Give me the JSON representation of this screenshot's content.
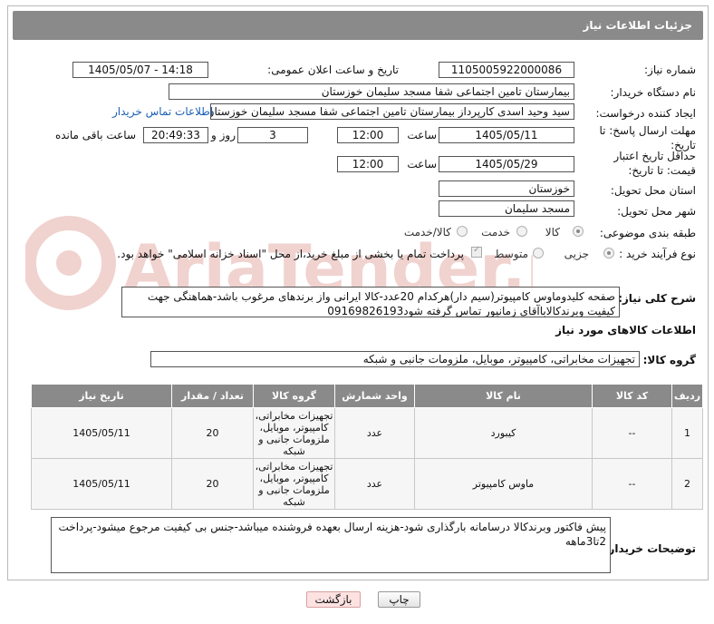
{
  "header": {
    "title": "جزئیات اطلاعات نیاز"
  },
  "fields": {
    "need_number_label": "شماره نیاز:",
    "need_number": "1105005922000086",
    "announce_label": "تاریخ و ساعت اعلان عمومی:",
    "announce_value": "1405/05/07 - 14:18",
    "buyer_org_label": "نام دستگاه خریدار:",
    "buyer_org": "بیمارستان تامین اجتماعی شفا مسجد سلیمان خوزستان",
    "requester_label": "ایجاد کننده درخواست:",
    "requester": "سید وحید اسدی کارپرداز بیمارستان تامین اجتماعی شفا مسجد سلیمان خوزستان",
    "contact_link": "اطلاعات تماس خریدار",
    "deadline_label": "مهلت ارسال پاسخ: تا تاریخ:",
    "deadline_date": "1405/05/11",
    "time_label": "ساعت",
    "deadline_time": "12:00",
    "days_value": "3",
    "days_label": "روز و",
    "remaining_time": "20:49:33",
    "remaining_label": "ساعت باقی مانده",
    "validity_label": "حداقل تاریخ اعتبار قیمت: تا تاریخ:",
    "validity_date": "1405/05/29",
    "validity_time": "12:00",
    "province_label": "استان محل تحویل:",
    "province": "خوزستان",
    "city_label": "شهر محل تحویل:",
    "city": "مسجد سلیمان",
    "category_label": "طبقه بندی موضوعی:",
    "category_options": [
      "کالا",
      "خدمت",
      "کالا/خدمت"
    ],
    "process_label": "نوع فرآیند خرید :",
    "process_options": [
      "جزیی",
      "متوسط"
    ],
    "payment_note": "پرداخت تمام یا بخشی از مبلغ خرید،از محل \"اسناد خزانه اسلامی\" خواهد بود."
  },
  "summary": {
    "label": "شرح کلی نیاز:",
    "text": "صفحه کلیدوماوس کامپیوتر(سیم دار)هرکدام 20عدد-کالا ایرانی واز برندهای مرغوب باشد-هماهنگی جهت کیفیت وبرندکالاباآقای زمانپور تماس گرفته شود09169826193"
  },
  "goods_info": {
    "title": "اطلاعات کالاهای مورد نیاز",
    "group_label": "گروه کالا:",
    "group_value": "تجهیزات مخابراتی، کامپیوتر، موبایل، ملزومات جانبی و شبکه",
    "columns": [
      "ردیف",
      "کد کالا",
      "نام کالا",
      "واحد شمارش",
      "گروه کالا",
      "تعداد / مقدار",
      "تاریخ نیاز"
    ],
    "rows": [
      [
        "1",
        "--",
        "کیبورد",
        "عدد",
        "تجهیزات مخابراتی، کامپیوتر، موبایل، ملزومات جانبی و شبکه",
        "20",
        "1405/05/11"
      ],
      [
        "2",
        "--",
        "ماوس کامپیوتر",
        "عدد",
        "تجهیزات مخابراتی، کامپیوتر، موبایل، ملزومات جانبی و شبکه",
        "20",
        "1405/05/11"
      ]
    ]
  },
  "buyer_notes": {
    "label": "توضیحات خریدار:",
    "text": "پیش فاکتور وبرندکالا درسامانه بارگذاری شود-هزینه ارسال بعهده فروشنده میباشد-جنس بی کیفیت مرجوع میشود-پرداخت 2تا3ماهه"
  },
  "buttons": {
    "print": "چاپ",
    "back": "بازگشت"
  },
  "watermark": {
    "text": "AriaTender.net"
  },
  "colors": {
    "header_bg": "#8a8a8a",
    "link": "#1a5fb4",
    "back_btn": "#fde2e2"
  }
}
